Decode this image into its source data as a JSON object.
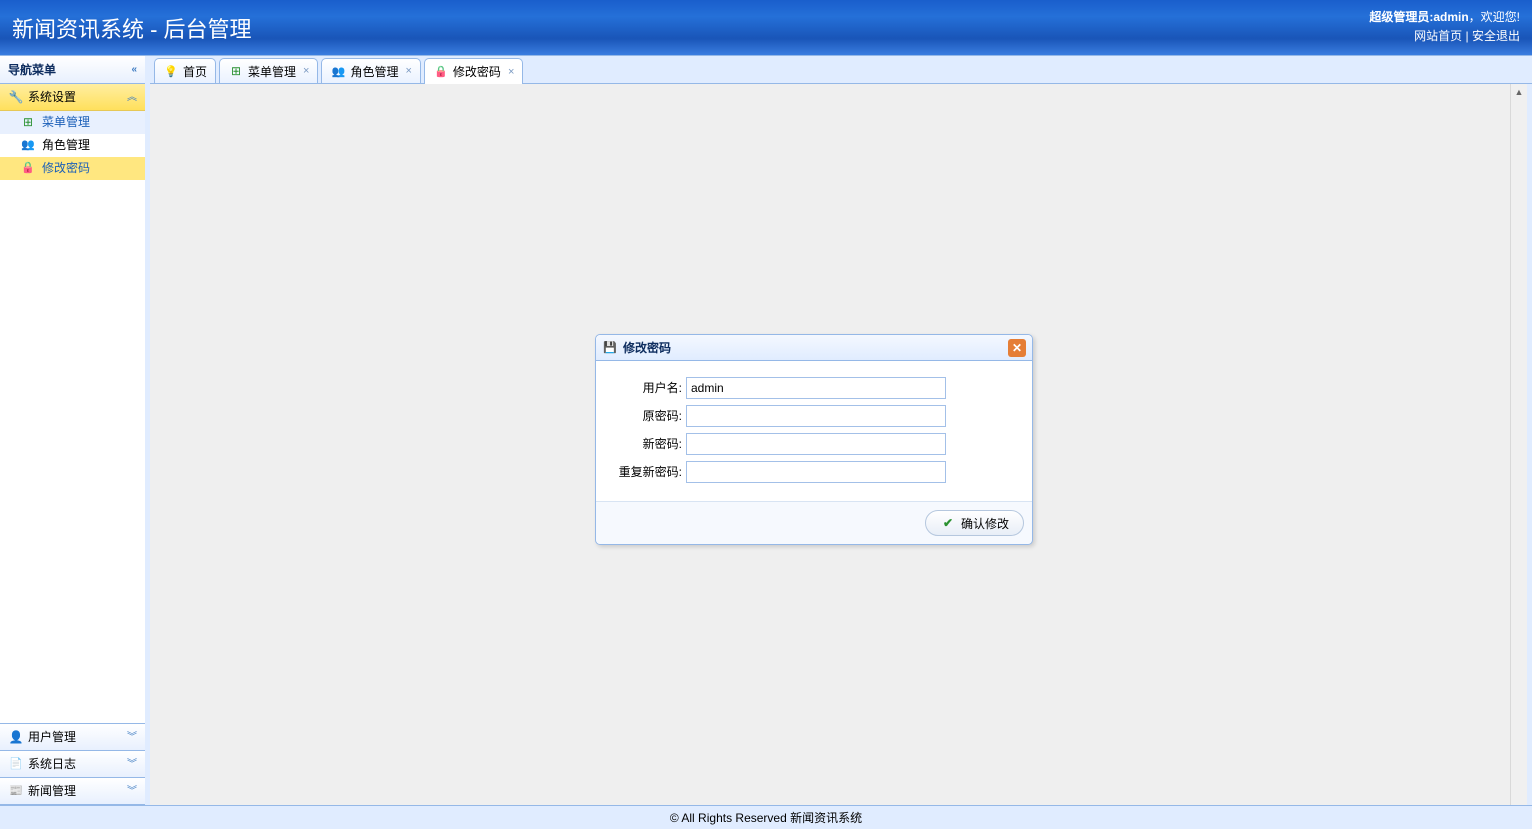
{
  "header": {
    "title": "新闻资讯系统 - 后台管理",
    "welcome_prefix": "超级管理员:",
    "welcome_user": "admin",
    "welcome_suffix": "，欢迎您!",
    "link_home": "网站首页",
    "link_sep": " | ",
    "link_logout": "安全退出"
  },
  "sidebar": {
    "title": "导航菜单",
    "panels": [
      {
        "label": "系统设置",
        "icon": "wrench",
        "expanded": true,
        "selected": true,
        "items": [
          {
            "label": "菜单管理",
            "icon": "grid",
            "state": "hover"
          },
          {
            "label": "角色管理",
            "icon": "users",
            "state": ""
          },
          {
            "label": "修改密码",
            "icon": "lockorange",
            "state": "sel"
          }
        ]
      },
      {
        "label": "用户管理",
        "icon": "user",
        "expanded": false
      },
      {
        "label": "系统日志",
        "icon": "doc",
        "expanded": false
      },
      {
        "label": "新闻管理",
        "icon": "rss",
        "expanded": false
      }
    ]
  },
  "tabs": [
    {
      "label": "首页",
      "icon": "bulb",
      "closable": false,
      "active": false
    },
    {
      "label": "菜单管理",
      "icon": "grid",
      "closable": true,
      "active": false
    },
    {
      "label": "角色管理",
      "icon": "users",
      "closable": true,
      "active": false
    },
    {
      "label": "修改密码",
      "icon": "lockorange",
      "closable": true,
      "active": true
    }
  ],
  "dialog": {
    "title": "修改密码",
    "fields": {
      "username_label": "用户名:",
      "username_value": "admin",
      "oldpwd_label": "原密码:",
      "newpwd_label": "新密码:",
      "repeat_label": "重复新密码:"
    },
    "submit": "确认修改"
  },
  "footer": "© All Rights Reserved 新闻资讯系统"
}
